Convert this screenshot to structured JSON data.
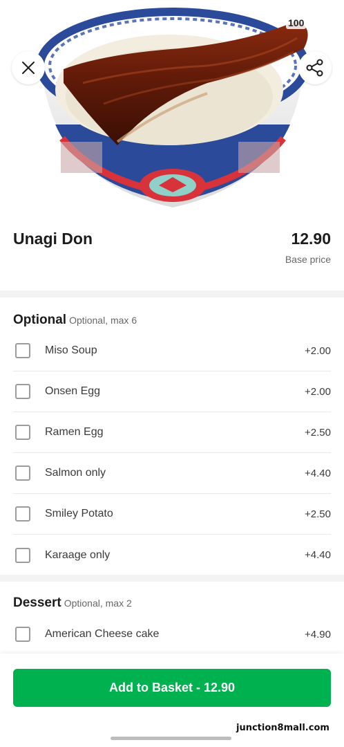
{
  "hero": {
    "badge": "100",
    "image_icon": "unagi-don-bowl-photo"
  },
  "item": {
    "name": "Unagi Don",
    "price": "12.90",
    "price_caption": "Base price"
  },
  "sections": [
    {
      "title": "Optional",
      "subtitle": "Optional, max 6",
      "options": [
        {
          "label": "Miso Soup",
          "price": "+2.00"
        },
        {
          "label": "Onsen Egg",
          "price": "+2.00"
        },
        {
          "label": "Ramen Egg",
          "price": "+2.50"
        },
        {
          "label": "Salmon only",
          "price": "+4.40"
        },
        {
          "label": "Smiley Potato",
          "price": "+2.50"
        },
        {
          "label": "Karaage only",
          "price": "+4.40"
        }
      ]
    },
    {
      "title": "Dessert",
      "subtitle": "Optional, max 2",
      "options": [
        {
          "label": "American Cheese cake",
          "price": "+4.90"
        }
      ]
    }
  ],
  "footer": {
    "add_button_label": "Add to Basket - 12.90",
    "watermark": "junction8mall.com"
  },
  "colors": {
    "accent": "#00b14f",
    "text": "#1c1c1c",
    "muted": "#676767",
    "divider": "#f3f3f3"
  }
}
